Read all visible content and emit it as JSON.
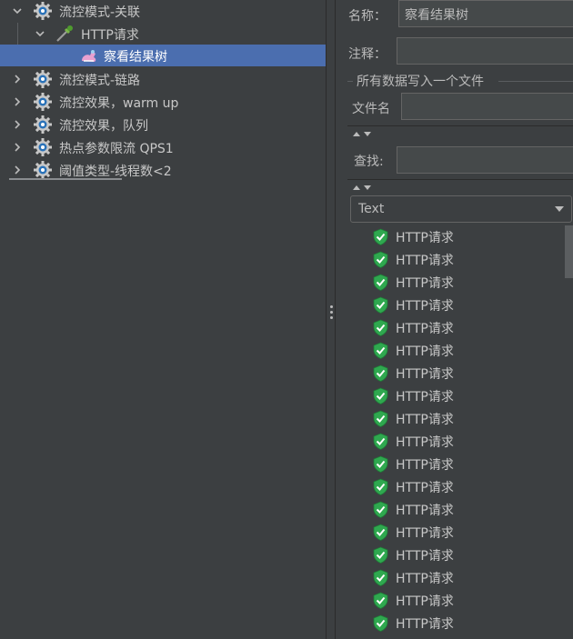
{
  "tree": {
    "items": [
      {
        "label": "流控模式-关联",
        "expanded": true,
        "icon": "thread-group-gear-icon"
      },
      {
        "label": "HTTP请求",
        "expanded": true,
        "icon": "http-sampler-pipette-icon"
      },
      {
        "label": "察看结果树",
        "selected": true,
        "icon": "results-tree-listener-icon"
      },
      {
        "label": "流控模式-链路",
        "expanded": false,
        "icon": "thread-group-gear-icon"
      },
      {
        "label": "流控效果，warm up",
        "expanded": false,
        "icon": "thread-group-gear-icon"
      },
      {
        "label": "流控效果，队列",
        "expanded": false,
        "icon": "thread-group-gear-icon"
      },
      {
        "label": "热点参数限流 QPS1",
        "expanded": false,
        "icon": "thread-group-gear-icon"
      },
      {
        "label": "阈值类型-线程数<2",
        "expanded": false,
        "icon": "thread-group-gear-icon"
      }
    ]
  },
  "panel": {
    "name_label": "名称：",
    "name_value": "察看结果树",
    "comment_label": "注释：",
    "comment_value": "",
    "file_group_title": "所有数据写入一个文件",
    "filename_label": "文件名",
    "filename_value": "",
    "search_label": "查找:",
    "search_value": "",
    "renderer_selected": "Text",
    "results": [
      {
        "label": "HTTP请求",
        "status": "success"
      },
      {
        "label": "HTTP请求",
        "status": "success"
      },
      {
        "label": "HTTP请求",
        "status": "success"
      },
      {
        "label": "HTTP请求",
        "status": "success"
      },
      {
        "label": "HTTP请求",
        "status": "success"
      },
      {
        "label": "HTTP请求",
        "status": "success"
      },
      {
        "label": "HTTP请求",
        "status": "success"
      },
      {
        "label": "HTTP请求",
        "status": "success"
      },
      {
        "label": "HTTP请求",
        "status": "success"
      },
      {
        "label": "HTTP请求",
        "status": "success"
      },
      {
        "label": "HTTP请求",
        "status": "success"
      },
      {
        "label": "HTTP请求",
        "status": "success"
      },
      {
        "label": "HTTP请求",
        "status": "success"
      },
      {
        "label": "HTTP请求",
        "status": "success"
      },
      {
        "label": "HTTP请求",
        "status": "success"
      },
      {
        "label": "HTTP请求",
        "status": "success"
      },
      {
        "label": "HTTP请求",
        "status": "success"
      },
      {
        "label": "HTTP请求",
        "status": "success"
      }
    ]
  },
  "colors": {
    "background": "#3c3f41",
    "selection": "#4b6eaf",
    "success_green": "#2fa84f",
    "text": "#bbbbbb"
  }
}
